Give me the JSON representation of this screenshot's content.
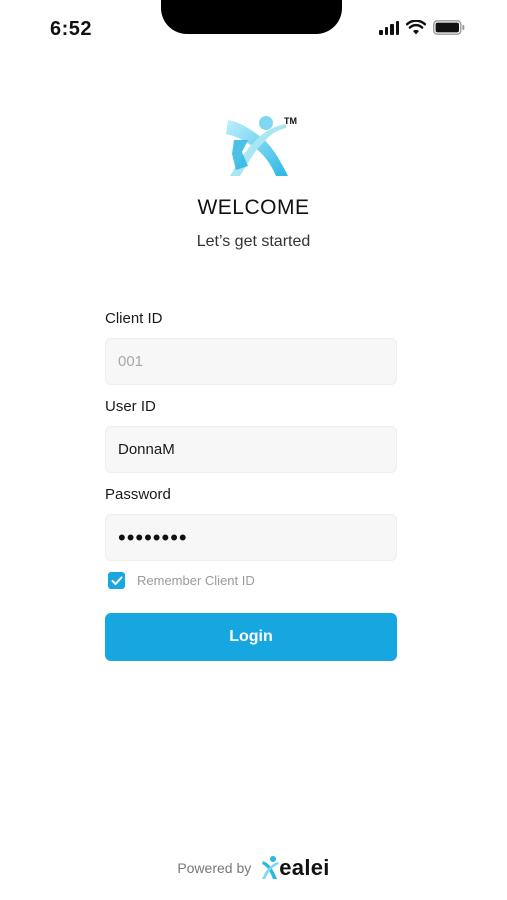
{
  "status": {
    "time": "6:52"
  },
  "header": {
    "title": "WELCOME",
    "subtitle": "Let’s get started",
    "trademark": "TM"
  },
  "form": {
    "client_id": {
      "label": "Client ID",
      "placeholder": "001"
    },
    "user_id": {
      "label": "User ID",
      "value": "DonnaM"
    },
    "password": {
      "label": "Password",
      "value": "••••••••"
    },
    "remember": {
      "label": "Remember Client ID",
      "checked": true
    },
    "login_label": "Login"
  },
  "footer": {
    "powered_label": "Powered by",
    "brand": "Xealei"
  },
  "colors": {
    "accent": "#16a7e1",
    "logo_light": "#a9e6f4",
    "logo_dark": "#2bb6e4"
  }
}
